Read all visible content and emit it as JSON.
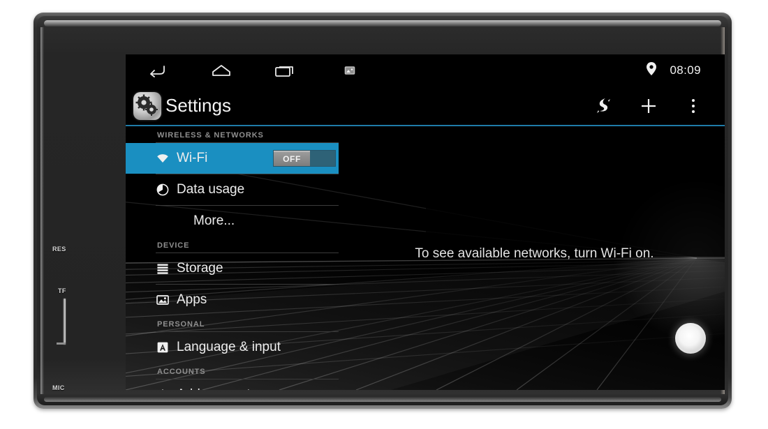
{
  "device": {
    "bezel_labels": {
      "res": "RES",
      "tf": "TF",
      "mic": "MIC"
    }
  },
  "status_bar": {
    "nav": [
      {
        "name": "back-icon",
        "label": "Back"
      },
      {
        "name": "home-icon",
        "label": "Home"
      },
      {
        "name": "recents-icon",
        "label": "Recent apps"
      },
      {
        "name": "screenshot-icon",
        "label": "Screenshot"
      }
    ],
    "location_icon": "location-pin-icon",
    "time": "08:09"
  },
  "action_bar": {
    "app_icon": "settings-gears-icon",
    "title": "Settings",
    "icons": [
      {
        "name": "flash-icon",
        "label": "Flash"
      },
      {
        "name": "add-icon",
        "label": "Add"
      },
      {
        "name": "overflow-menu-icon",
        "label": "More options"
      }
    ],
    "divider_color": "#1f7ca8"
  },
  "settings": {
    "accent_color": "#1a8fc1",
    "sections": [
      {
        "header": "WIRELESS & NETWORKS",
        "items": [
          {
            "id": "wifi",
            "label": "Wi-Fi",
            "icon": "wifi-icon",
            "selected": true,
            "toggle": {
              "state": "OFF",
              "on": false
            }
          },
          {
            "id": "data-usage",
            "label": "Data usage",
            "icon": "data-usage-icon",
            "selected": false
          },
          {
            "id": "more",
            "label": "More...",
            "icon": "none",
            "selected": false,
            "indented": true
          }
        ]
      },
      {
        "header": "DEVICE",
        "items": [
          {
            "id": "storage",
            "label": "Storage",
            "icon": "storage-icon",
            "selected": false
          },
          {
            "id": "apps",
            "label": "Apps",
            "icon": "apps-icon",
            "selected": false
          }
        ]
      },
      {
        "header": "PERSONAL",
        "items": [
          {
            "id": "language-input",
            "label": "Language & input",
            "icon": "language-input-icon",
            "selected": false
          }
        ]
      },
      {
        "header": "ACCOUNTS",
        "items": [
          {
            "id": "add-account",
            "label": "Add account",
            "icon": "plus-icon",
            "selected": false
          }
        ]
      }
    ]
  },
  "content_pane": {
    "empty_message": "To see available networks, turn Wi-Fi on."
  },
  "hardware": {
    "power_button": "power-button"
  }
}
